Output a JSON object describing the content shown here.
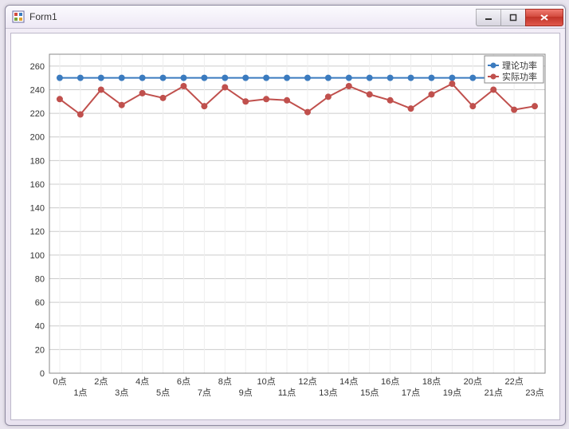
{
  "window": {
    "title": "Form1"
  },
  "chart_data": {
    "type": "line",
    "ylim": [
      0,
      270
    ],
    "y_ticks": [
      0,
      20,
      40,
      60,
      80,
      100,
      120,
      140,
      160,
      180,
      200,
      220,
      240,
      260
    ],
    "categories": [
      "0点",
      "1点",
      "2点",
      "3点",
      "4点",
      "5点",
      "6点",
      "7点",
      "8点",
      "9点",
      "10点",
      "11点",
      "12点",
      "13点",
      "14点",
      "15点",
      "16点",
      "17点",
      "18点",
      "19点",
      "20点",
      "21点",
      "22点",
      "23点"
    ],
    "series": [
      {
        "name": "理论功率",
        "color": "#3b7bbf",
        "values": [
          250,
          250,
          250,
          250,
          250,
          250,
          250,
          250,
          250,
          250,
          250,
          250,
          250,
          250,
          250,
          250,
          250,
          250,
          250,
          250,
          250,
          250,
          250,
          250
        ]
      },
      {
        "name": "实际功率",
        "color": "#c0504d",
        "values": [
          232,
          219,
          240,
          227,
          237,
          233,
          243,
          226,
          242,
          230,
          232,
          231,
          221,
          234,
          243,
          236,
          231,
          224,
          236,
          245,
          226,
          240,
          223,
          226
        ]
      }
    ],
    "title": "",
    "xlabel": "",
    "ylabel": "",
    "legend_position": "top-right"
  }
}
